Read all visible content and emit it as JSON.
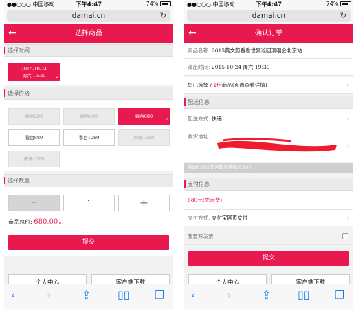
{
  "status": {
    "carrier": "●●○○○ 中国移动",
    "time": "下午4:47",
    "battery": "74%"
  },
  "browser": {
    "url": "damai.cn",
    "reload_icon": "reload-icon"
  },
  "toolbar_icons": [
    "back-icon",
    "forward-icon",
    "share-icon",
    "bookmarks-icon",
    "tabs-icon"
  ],
  "left": {
    "title": "选择商品",
    "back": "←",
    "time_section": "选择时间",
    "date_chip": {
      "line1": "2015-10-24",
      "line2": "周六 19:30"
    },
    "price_section": "选择价格",
    "prices": [
      {
        "label": "看台280",
        "state": "disabled"
      },
      {
        "label": "看台480",
        "state": "disabled"
      },
      {
        "label": "看台680",
        "state": "selected"
      },
      {
        "label": "看台880",
        "state": "normal"
      },
      {
        "label": "看台1080",
        "state": "normal"
      },
      {
        "label": "内场1280",
        "state": "disabled"
      },
      {
        "label": "内场1680",
        "state": "disabled"
      }
    ],
    "qty_section": "选择数量",
    "qty": {
      "minus": "—",
      "value": "1",
      "plus": "+"
    },
    "total": {
      "label": "商品总价:",
      "amount": "680.00",
      "unit": "元"
    },
    "submit": "提交",
    "bottom_tabs": [
      "个人中心",
      "客户端下载"
    ]
  },
  "right": {
    "title": "确认订单",
    "back": "←",
    "product": {
      "label": "商品名称:",
      "value": "2015莫文蔚看看世界巡回演唱会北京站"
    },
    "show_time": {
      "label": "演出时间:",
      "value": "2015-10-24 周六 19:30"
    },
    "selected": {
      "prefix": "您已选择了",
      "count": "1份",
      "suffix": "商品(点击查看详情)"
    },
    "delivery_section": "配送信息",
    "delivery": {
      "label": "配送方式:",
      "value": "快递"
    },
    "address": {
      "label": "收货地址:"
    },
    "freight_note": "满100.00元免运费,不满收10.00元",
    "pay_section": "支付信息",
    "pay_amount": "680元(免运费)",
    "pay_method": {
      "label": "支付方式:",
      "value": "支付宝网页支付"
    },
    "invoice": "我要开发票",
    "submit": "提交",
    "bottom_tabs": [
      "个人中心",
      "客户端下载"
    ]
  },
  "colors": {
    "accent": "#e8194f",
    "link": "#1a7cf5"
  }
}
